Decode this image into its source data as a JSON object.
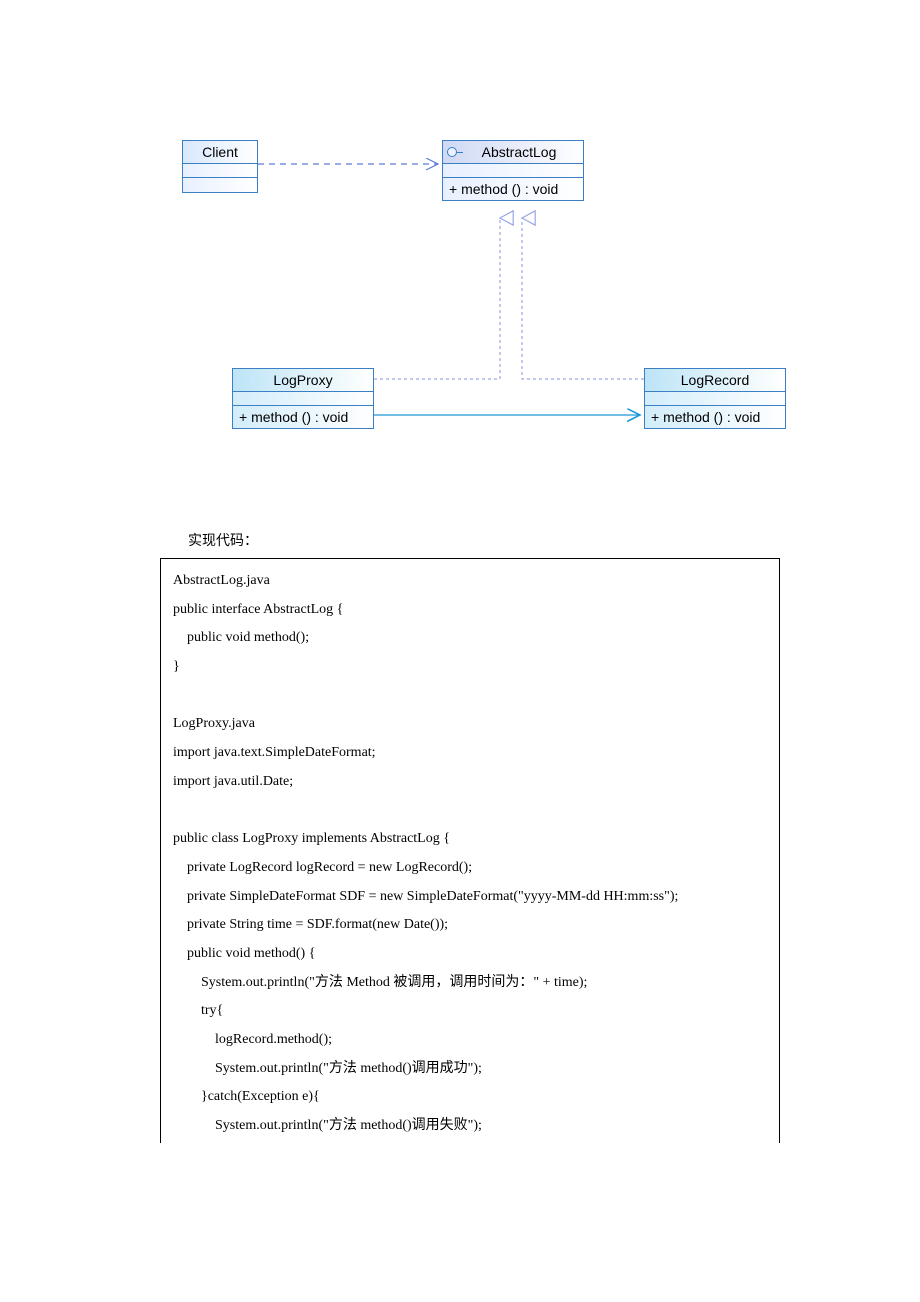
{
  "diagram": {
    "client": {
      "name": "Client"
    },
    "abstractLog": {
      "name": "AbstractLog",
      "op": "+  method ()  : void"
    },
    "logProxy": {
      "name": "LogProxy",
      "op": "+  method ()  : void"
    },
    "logRecord": {
      "name": "LogRecord",
      "op": "+  method ()  : void"
    }
  },
  "sectionLabel": "实现代码：",
  "code": {
    "l01": "AbstractLog.java",
    "l02": "public interface AbstractLog {",
    "l03": "    public void method();",
    "l04": "}",
    "l05": "",
    "l06": "LogProxy.java",
    "l07": "import java.text.SimpleDateFormat;",
    "l08": "import java.util.Date;",
    "l09": "",
    "l10": "public class LogProxy implements AbstractLog {",
    "l11": "    private LogRecord logRecord = new LogRecord();",
    "l12": "    private SimpleDateFormat SDF = new SimpleDateFormat(\"yyyy-MM-dd HH:mm:ss\");",
    "l13": "    private String time = SDF.format(new Date());",
    "l14": "    public void method() {",
    "l15": "        System.out.println(\"方法 Method 被调用，调用时间为：\" + time);",
    "l16": "        try{",
    "l17": "            logRecord.method();",
    "l18": "            System.out.println(\"方法 method()调用成功\");",
    "l19": "        }catch(Exception e){",
    "l20": "            System.out.println(\"方法 method()调用失败\");"
  }
}
